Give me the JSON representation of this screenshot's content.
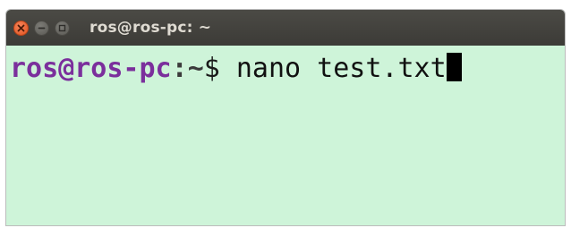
{
  "window": {
    "title": "ros@ros-pc: ~"
  },
  "controls": {
    "close_icon": "close-icon",
    "minimize_icon": "minimize-icon",
    "maximize_icon": "maximize-icon"
  },
  "terminal": {
    "prompt_user": "ros@ros-pc",
    "prompt_sep": ":",
    "prompt_path": "~",
    "prompt_symbol": "$ ",
    "command": "nano test.txt"
  },
  "colors": {
    "background": "#cef4d9",
    "titlebar": "#3c3b37",
    "prompt_user": "#7b2f9c",
    "close_button": "#e0531f"
  }
}
